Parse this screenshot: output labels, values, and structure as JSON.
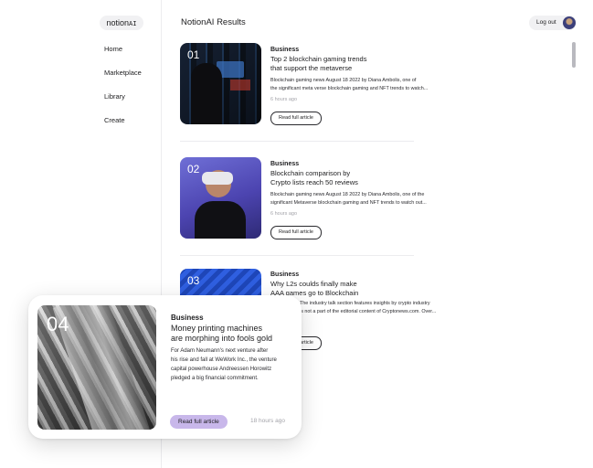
{
  "app": {
    "logo_text": "notion",
    "logo_suffix": "AI"
  },
  "sidebar": {
    "items": [
      {
        "label": "Home"
      },
      {
        "label": "Marketplace"
      },
      {
        "label": "Library"
      },
      {
        "label": "Create"
      }
    ]
  },
  "header": {
    "title": "NotionAI Results",
    "logout_label": "Log out"
  },
  "articles": [
    {
      "number": "01",
      "category": "Business",
      "headline_line1": "Top 2 blockchain gaming trends",
      "headline_line2": "that support the metaverse",
      "excerpt_line1": "Blockchain gaming news August 18 2022 by Diana Ambolis, one of",
      "excerpt_line2": "the significant meta verse blockchain gaming and NFT trends to watch...",
      "time": "6 hours ago",
      "button": "Read full article"
    },
    {
      "number": "02",
      "category": "Business",
      "headline_line1": "Blockchain comparison by",
      "headline_line2": "Crypto lists reach 50 reviews",
      "excerpt_line1": "Blockchain gaming news August 18 2022 by Diana Ambolis, one of the",
      "excerpt_line2": "significant Metaverse blockchain gaming and NFT trends to watch out...",
      "time": "6 hours ago",
      "button": "Read full article"
    },
    {
      "number": "03",
      "category": "Business",
      "headline_line1": "Why L2s coulds finally make",
      "headline_line2": "AAA games go to Blockchain",
      "excerpt_line1": "The industry talk section features insights by crypto industry",
      "excerpt_line2": "is not a part of the editorial content of Cryptonews.com. Over...",
      "button": "Read full article"
    }
  ],
  "featured": {
    "number": "04",
    "category": "Business",
    "headline_line1": "Money printing machines",
    "headline_line2": "are morphing into fools gold",
    "excerpt_line1": "For Adam Neumann's next venture after",
    "excerpt_line2": "his rise and fall at WeWork Inc., the venture",
    "excerpt_line3": "capital powerhouse Andreessen Horowitz",
    "excerpt_line4": "pledged a big financial commitment.",
    "button": "Read full article",
    "time": "18 hours ago"
  },
  "colors": {
    "accent": "#c8b7ea",
    "muted_text": "#a4a4aa"
  }
}
